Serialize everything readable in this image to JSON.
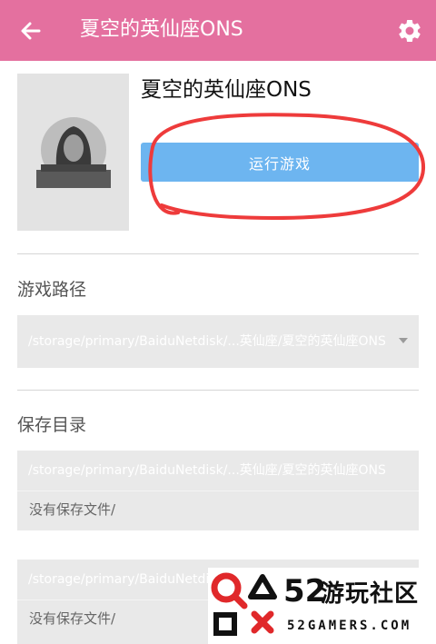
{
  "appbar": {
    "title": "夏空的英仙座ONS",
    "back_icon": "arrow-left-icon",
    "settings_icon": "gear-icon",
    "color": "#e4709f"
  },
  "game": {
    "name": "夏空的英仙座ONS",
    "run_button_label": "运行游戏",
    "run_button_color": "#6db5f0"
  },
  "game_path": {
    "label": "游戏路径",
    "value": "/storage/primary/BaiduNetdisk/...英仙座/夏空的英仙座ONS"
  },
  "save_dir": {
    "label": "保存目录",
    "entries": [
      {
        "path": "/storage/primary/BaiduNetdisk/...英仙座/夏空的英仙座ONS",
        "status": "没有保存文件/"
      },
      {
        "path": "/storage/primary/BaiduNetdisk/...英仙座/夏空的英仙座ONS",
        "status": "没有保存文件/"
      }
    ]
  },
  "watermark": {
    "number": "52",
    "name": "游玩社区",
    "domain": "52GAMERS.COM"
  }
}
